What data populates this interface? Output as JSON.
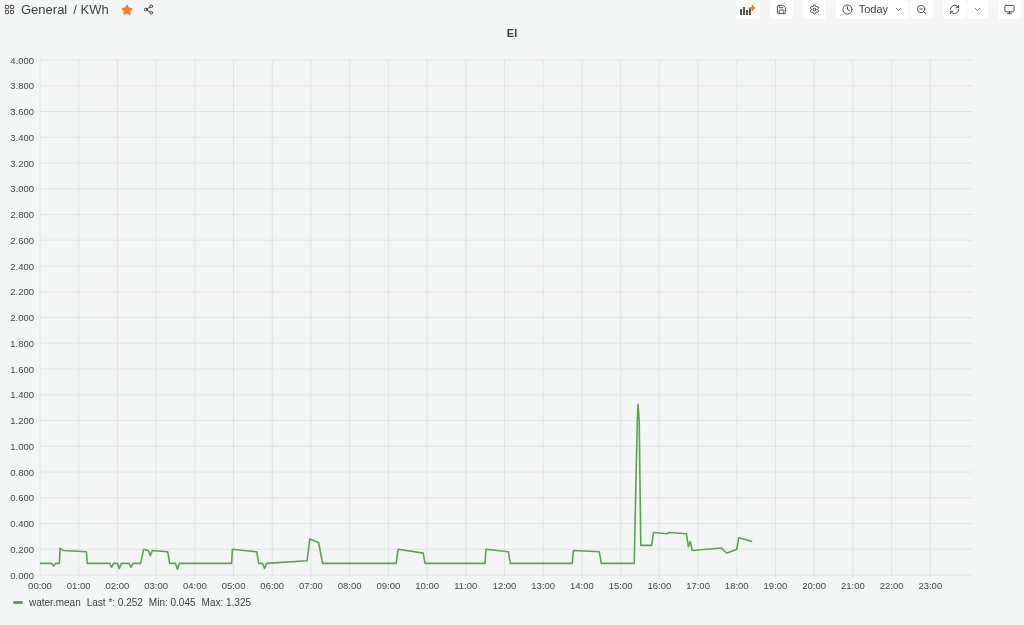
{
  "header": {
    "breadcrumb": [
      "General",
      "/ KWh"
    ],
    "starred": true
  },
  "toolbar": {
    "time_range": "Today"
  },
  "panel": {
    "title": "El",
    "chart_data": {
      "type": "line",
      "grid": true,
      "xlim": [
        0,
        24
      ],
      "ylim": [
        0,
        4
      ],
      "x": [
        0,
        0.3,
        0.35,
        0.4,
        0.5,
        0.52,
        0.6,
        1.2,
        1.22,
        1.8,
        1.85,
        1.9,
        2.0,
        2.05,
        2.1,
        2.3,
        2.35,
        2.4,
        2.6,
        2.68,
        2.8,
        2.85,
        2.9,
        3.3,
        3.35,
        3.5,
        3.55,
        3.6,
        4.95,
        4.97,
        5.6,
        5.65,
        5.75,
        5.8,
        5.85,
        6.9,
        6.97,
        7.05,
        7.2,
        7.3,
        9.2,
        9.25,
        9.9,
        9.95,
        11.5,
        11.52,
        12.1,
        12.15,
        13.75,
        13.78,
        14.45,
        14.5,
        15.35,
        15.43,
        15.45,
        15.48,
        15.52,
        15.8,
        15.85,
        16.2,
        16.25,
        16.7,
        16.75,
        16.8,
        16.85,
        17.6,
        17.7,
        17.75,
        18.0,
        18.05,
        18.4
      ],
      "series": [
        {
          "name": "water.mean",
          "color": "#56a64b",
          "values": [
            0.09,
            0.09,
            0.07,
            0.09,
            0.09,
            0.21,
            0.19,
            0.18,
            0.09,
            0.09,
            0.06,
            0.09,
            0.09,
            0.05,
            0.09,
            0.09,
            0.06,
            0.09,
            0.09,
            0.2,
            0.19,
            0.15,
            0.19,
            0.18,
            0.09,
            0.09,
            0.045,
            0.09,
            0.09,
            0.2,
            0.18,
            0.09,
            0.09,
            0.05,
            0.09,
            0.11,
            0.28,
            0.27,
            0.25,
            0.09,
            0.09,
            0.2,
            0.17,
            0.09,
            0.09,
            0.2,
            0.18,
            0.09,
            0.09,
            0.19,
            0.18,
            0.09,
            0.09,
            1.2,
            1.325,
            1.2,
            0.23,
            0.23,
            0.33,
            0.32,
            0.33,
            0.32,
            0.22,
            0.26,
            0.19,
            0.21,
            0.18,
            0.17,
            0.2,
            0.29,
            0.26
          ]
        }
      ],
      "yticks": [
        {
          "value": 0,
          "label": "0.000"
        },
        {
          "value": 0.2,
          "label": "0.200"
        },
        {
          "value": 0.4,
          "label": "0.400"
        },
        {
          "value": 0.6,
          "label": "0.600"
        },
        {
          "value": 0.8,
          "label": "0.800"
        },
        {
          "value": 1,
          "label": "1.000"
        },
        {
          "value": 1.2,
          "label": "1.200"
        },
        {
          "value": 1.4,
          "label": "1.400"
        },
        {
          "value": 1.6,
          "label": "1.600"
        },
        {
          "value": 1.8,
          "label": "1.800"
        },
        {
          "value": 2,
          "label": "2.000"
        },
        {
          "value": 2.2,
          "label": "2.200"
        },
        {
          "value": 2.4,
          "label": "2.400"
        },
        {
          "value": 2.6,
          "label": "2.600"
        },
        {
          "value": 2.8,
          "label": "2.800"
        },
        {
          "value": 3,
          "label": "3.000"
        },
        {
          "value": 3.2,
          "label": "3.200"
        },
        {
          "value": 3.4,
          "label": "3.400"
        },
        {
          "value": 3.6,
          "label": "3.600"
        },
        {
          "value": 3.8,
          "label": "3.800"
        },
        {
          "value": 4,
          "label": "4.000"
        }
      ],
      "xticks": [
        {
          "value": 0,
          "label": "00:00"
        },
        {
          "value": 1,
          "label": "01:00"
        },
        {
          "value": 2,
          "label": "02:00"
        },
        {
          "value": 3,
          "label": "03:00"
        },
        {
          "value": 4,
          "label": "04:00"
        },
        {
          "value": 5,
          "label": "05:00"
        },
        {
          "value": 6,
          "label": "06:00"
        },
        {
          "value": 7,
          "label": "07:00"
        },
        {
          "value": 8,
          "label": "08:00"
        },
        {
          "value": 9,
          "label": "09:00"
        },
        {
          "value": 10,
          "label": "10:00"
        },
        {
          "value": 11,
          "label": "11:00"
        },
        {
          "value": 12,
          "label": "12:00"
        },
        {
          "value": 13,
          "label": "13:00"
        },
        {
          "value": 14,
          "label": "14:00"
        },
        {
          "value": 15,
          "label": "15:00"
        },
        {
          "value": 16,
          "label": "16:00"
        },
        {
          "value": 17,
          "label": "17:00"
        },
        {
          "value": 18,
          "label": "18:00"
        },
        {
          "value": 19,
          "label": "19:00"
        },
        {
          "value": 20,
          "label": "20:00"
        },
        {
          "value": 21,
          "label": "21:00"
        },
        {
          "value": 22,
          "label": "22:00"
        },
        {
          "value": 23,
          "label": "23:00"
        }
      ]
    },
    "legend": {
      "stats": [
        "Last *: 0.252",
        "Min: 0.045",
        "Max: 1.325"
      ]
    }
  }
}
